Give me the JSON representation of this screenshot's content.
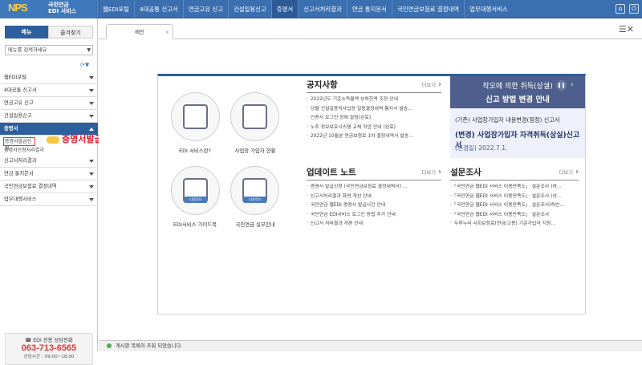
{
  "header": {
    "logo_mark": "NPS",
    "logo_line1": "국민연금",
    "logo_line2": "EDI 서비스",
    "nav": [
      "웹EDI포털",
      "4대공통 신고서",
      "연금고유 신고",
      "건설일용신고",
      "증명서",
      "신고서처리결과",
      "연금 통지문서",
      "국민연금보험료 결정내역",
      "업무대행서비스"
    ],
    "active_nav": "증명서"
  },
  "sidebar": {
    "tab_menu": "메뉴",
    "tab_favorites": "즐겨찾기",
    "search_placeholder": "메뉴를 검색하세요",
    "items": [
      {
        "label": "웹EDI포털"
      },
      {
        "label": "4대공통 신고서"
      },
      {
        "label": "연금고유 신고"
      },
      {
        "label": "건설일용신고"
      },
      {
        "label": "증명서",
        "open": true,
        "sub": [
          "증명서발급신청",
          "증명서신청처리결과"
        ]
      },
      {
        "label": "신고서처리결과"
      },
      {
        "label": "연금 통지문서"
      },
      {
        "label": "국민연금보험료 결정내역"
      },
      {
        "label": "업무대행서비스"
      }
    ],
    "annotation": "증명서발급신청",
    "phone_label": "☎ EDI 전용 상담전화",
    "phone_number": "063-713-6565",
    "phone_hours": "상담시간 : 09:00~18:00"
  },
  "main": {
    "tab_label": "메인",
    "services": [
      {
        "label": "EDI 서비스란?",
        "download": ""
      },
      {
        "label": "사업장 가입자 현황",
        "download": ""
      },
      {
        "label": "EDI서비스 가이드북",
        "download": "다운로드"
      },
      {
        "label": "국민연금 실무안내",
        "download": "다운로드"
      }
    ],
    "notice": {
      "title": "공지사항",
      "more": "더보기",
      "items": [
        "2022년도 기준소득월액 상하한액 조정 안내",
        "당월 건설일용직사업장 일용결정내역 통지서 발송…",
        "인증서 로그인 장애 알림(완료)",
        "노후 정보보호시스템 교체 작업 안내 (완료)",
        "2022년 10월분 연금보험료 1차 결정내역서 발송…"
      ]
    },
    "update": {
      "title": "업데이트 노트",
      "more": "더보기",
      "items": [
        "증명서 발급신청 (국민연금보험료 결정내역서) …",
        "신고서처리결과 화면 개선 안내",
        "국민연금 웹EDI 증명서 발급시간 안내",
        "국민연금 EDI서비스 로그인 방법 추가 안내",
        "신고서 처리결과 개편 안내"
      ]
    },
    "survey": {
      "title": "설문조사",
      "more": "더보기",
      "items": [
        "「국민연금 웹EDI 서비스 이용만족도」 설문조사 (하…",
        "「국민연금 웹EDI 서비스 이용만족도」 설문조사 (상…",
        "「국민연금 웹EDI 서비스 이용만족도」 설문조사(하반…",
        "「국민연금 웹EDI 서비스 이용만족도」 설문조사",
        "두루누리 사회보험료(연금/고용) 기준가입자 지원…"
      ]
    },
    "banner": {
      "line1": "착오에 의한 취득(상실)",
      "line2": "신고 방법 변경 안내",
      "sub1": "(기존) 사업장가입자 내용변경(정정) 신고서",
      "sub2": "(변경) 사업장가입자 자격취득(상실)신고서",
      "sub3": "(변경일) 2022.7.1."
    }
  },
  "status": {
    "text": "게시판 목록이 조회 되었습니다."
  }
}
